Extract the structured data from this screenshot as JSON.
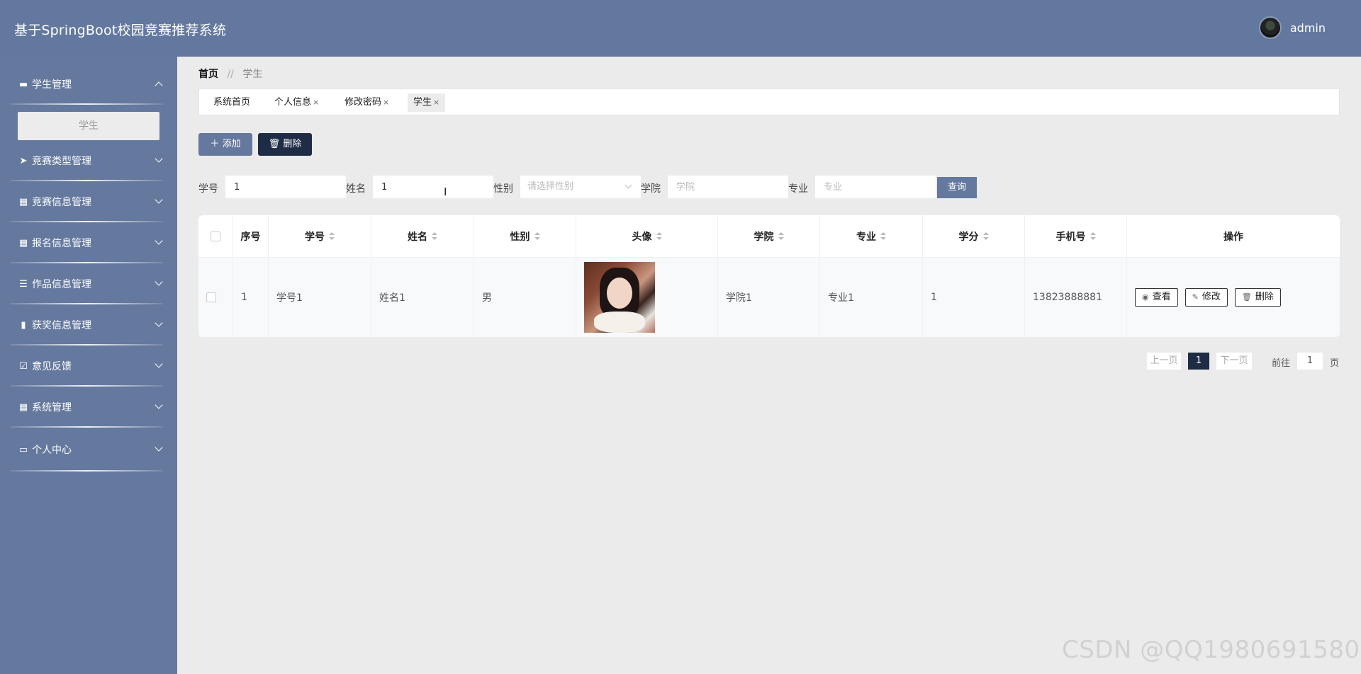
{
  "header": {
    "title": "基于SpringBoot校园竞赛推荐系统",
    "user": "admin"
  },
  "sidebar": {
    "items": [
      {
        "label": "学生管理",
        "icon": "ticket-icon"
      },
      {
        "label": "竞赛类型管理",
        "icon": "send-icon"
      },
      {
        "label": "竞赛信息管理",
        "icon": "grid-icon"
      },
      {
        "label": "报名信息管理",
        "icon": "grid-icon"
      },
      {
        "label": "作品信息管理",
        "icon": "sliders-icon"
      },
      {
        "label": "获奖信息管理",
        "icon": "book-icon"
      },
      {
        "label": "意见反馈",
        "icon": "clipboard-check-icon"
      },
      {
        "label": "系统管理",
        "icon": "grid-icon"
      },
      {
        "label": "个人中心",
        "icon": "card-icon"
      }
    ],
    "submenu": {
      "label": "学生"
    }
  },
  "breadcrumb": {
    "home": "首页",
    "sep": "//",
    "current": "学生"
  },
  "tabs": [
    {
      "label": "系统首页",
      "closable": ""
    },
    {
      "label": "个人信息",
      "closable": "×"
    },
    {
      "label": "修改密码",
      "closable": "×"
    },
    {
      "label": "学生",
      "closable": "×"
    }
  ],
  "actions": {
    "add": "添加",
    "delete": "删除"
  },
  "search": {
    "student_no_label": "学号",
    "student_no_value": "1",
    "name_label": "姓名",
    "name_value": "1",
    "gender_label": "性别",
    "gender_placeholder": "请选择性别",
    "college_label": "学院",
    "college_placeholder": "学院",
    "major_label": "专业",
    "major_placeholder": "专业",
    "query_button": "查询"
  },
  "table": {
    "headers": [
      "序号",
      "学号",
      "姓名",
      "性别",
      "头像",
      "学院",
      "专业",
      "学分",
      "手机号",
      "操作"
    ],
    "rows": [
      {
        "index": "1",
        "student_no": "学号1",
        "name": "姓名1",
        "gender": "男",
        "college": "学院1",
        "major": "专业1",
        "credits": "1",
        "phone": "13823888881"
      }
    ],
    "row_actions": {
      "view": "查看",
      "edit": "修改",
      "delete": "删除"
    }
  },
  "pagination": {
    "prev": "上一页",
    "current": "1",
    "next": "下一页",
    "goto_label": "前往",
    "goto_value": "1",
    "page_suffix": "页"
  },
  "watermark": "CSDN @QQ1980691580",
  "colors": {
    "header": "#63789f",
    "sidebar": "#65799f",
    "primary_dark": "#1e2c46",
    "background": "#ebebeb"
  }
}
